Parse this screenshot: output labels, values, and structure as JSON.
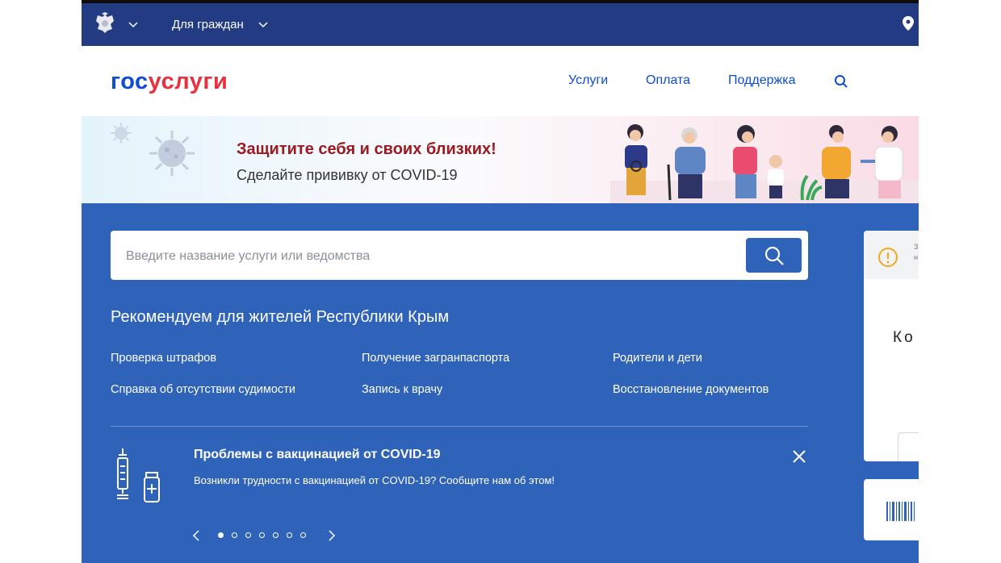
{
  "topbar": {
    "emblem_icon": "coat-of-arms-icon",
    "audience_label": "Для граждан",
    "location_icon": "location-pin-icon"
  },
  "header": {
    "logo_part1": "гос",
    "logo_part2": "услуги",
    "nav": [
      "Услуги",
      "Оплата",
      "Поддержка"
    ],
    "search_icon": "search-icon"
  },
  "banner": {
    "title": "Защитите себя и своих близких!",
    "subtitle": "Сделайте прививку от COVID-19"
  },
  "main": {
    "search": {
      "placeholder": "Введите название услуги или ведомства",
      "value": ""
    },
    "recommend_title": "Рекомендуем для жителей Республики Крым",
    "links": [
      "Проверка штрафов",
      "Получение загранпаспорта",
      "Родители и дети",
      "Справка об отсутствии судимости",
      "Запись к врачу",
      "Восстановление документов"
    ],
    "alert": {
      "title": "Проблемы с вакцинацией от COVID-19",
      "text": "Возникли трудности с вакцинацией от COVID-19? Сообщите нам об этом!"
    },
    "pager": {
      "total": 7,
      "active": 1
    }
  },
  "side": {
    "card_text_top": "З",
    "card_text_bottom": "н",
    "card_heading": "Ко"
  },
  "colors": {
    "topbar": "#233b83",
    "main": "#2f63b9",
    "brand_blue": "#0d4cd3",
    "brand_red": "#e8303f",
    "warning": "#f5a623"
  }
}
